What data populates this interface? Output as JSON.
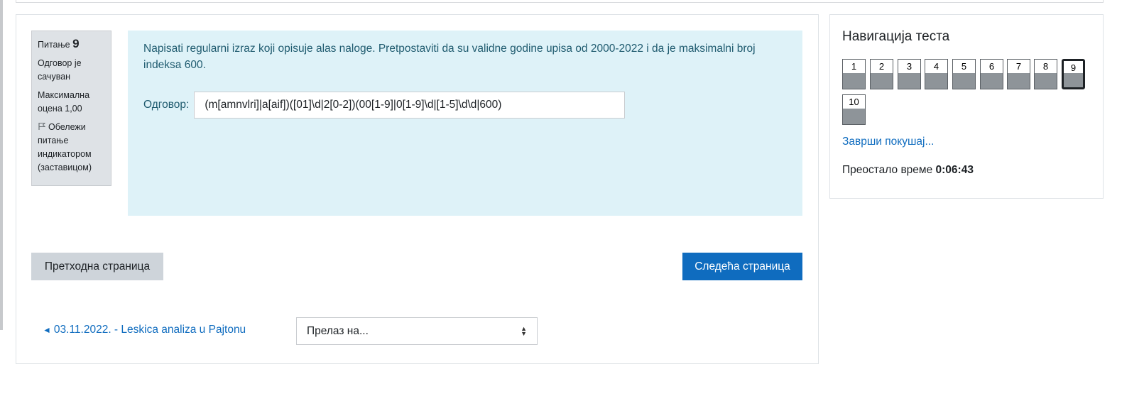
{
  "question": {
    "number_label": "Питање",
    "number": "9",
    "status": "Одговор је сачуван",
    "max_grade": "Максимална оцена 1,00",
    "flag_label": "Обележи питање индикатором (заставицом)",
    "text": "Napisati regularni izraz koji opisuje alas naloge. Pretpostaviti da su validne godine upisa od 2000-2022 i da je maksimalni broj indeksa 600.",
    "answer_label": "Одговор:",
    "answer_value": "(m[amnvlri]|a[aif])([01]\\d|2[0-2])(00[1-9]|0[1-9]\\d|[1-5]\\d\\d|600)"
  },
  "navigation_buttons": {
    "prev_label": "Претходна страница",
    "next_label": "Следећа страница"
  },
  "footer": {
    "prev_activity": "03.11.2022. - Leskica analiza u Pajtonu",
    "jump_placeholder": "Прелаз на..."
  },
  "quiz_nav": {
    "title": "Навигација теста",
    "questions": [
      "1",
      "2",
      "3",
      "4",
      "5",
      "6",
      "7",
      "8",
      "9",
      "10"
    ],
    "current": "9",
    "finish_label": "Заврши покушај...",
    "time_label": "Преостало време",
    "time_value": "0:06:43"
  },
  "colors": {
    "accent": "#0f6cbf",
    "question_bg": "#def2f8",
    "info_bg": "#dee2e6",
    "answered_fill": "#8e9499"
  }
}
